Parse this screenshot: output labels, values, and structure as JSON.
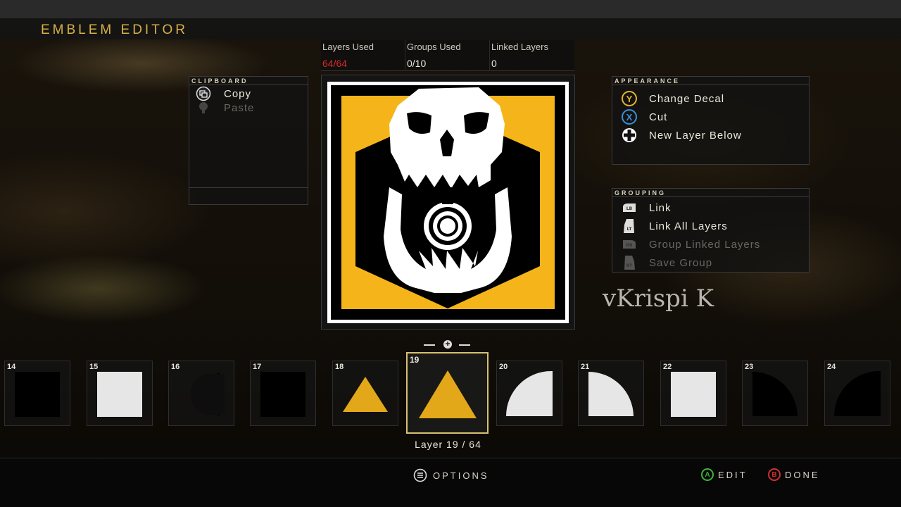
{
  "header": {
    "title": "EMBLEM EDITOR"
  },
  "stats": {
    "layers_used_label": "Layers Used",
    "layers_used_value": "64/64",
    "groups_used_label": "Groups Used",
    "groups_used_value": "0/10",
    "linked_layers_label": "Linked Layers",
    "linked_layers_value": "0"
  },
  "clipboard": {
    "heading": "CLIPBOARD",
    "items": [
      {
        "label": "Copy",
        "icon": "copy-icon",
        "enabled": true
      },
      {
        "label": "Paste",
        "icon": "paste-icon",
        "enabled": false
      }
    ]
  },
  "appearance": {
    "heading": "APPEARANCE",
    "items": [
      {
        "label": "Change Decal",
        "button": "Y",
        "color": "#e0b530"
      },
      {
        "label": "Cut",
        "button": "X",
        "color": "#3a8fd8"
      },
      {
        "label": "New Layer Below",
        "button": "dpad",
        "color": "#ffffff"
      }
    ]
  },
  "grouping": {
    "heading": "GROUPING",
    "items": [
      {
        "label": "Link",
        "button": "LB",
        "enabled": true
      },
      {
        "label": "Link All Layers",
        "button": "LT",
        "enabled": true
      },
      {
        "label": "Group Linked Layers",
        "button": "RB",
        "enabled": false
      },
      {
        "label": "Save Group",
        "button": "RT",
        "enabled": false
      }
    ]
  },
  "watermark": "vKrispi K",
  "layers": {
    "items": [
      {
        "num": "14",
        "shape": "square",
        "color": "#000000"
      },
      {
        "num": "15",
        "shape": "square",
        "color": "#e6e6e6"
      },
      {
        "num": "16",
        "shape": "crescent",
        "color": "#000000"
      },
      {
        "num": "17",
        "shape": "square",
        "color": "#000000"
      },
      {
        "num": "18",
        "shape": "triangle",
        "color": "#e3a71a"
      },
      {
        "num": "19",
        "shape": "triangle",
        "color": "#e3a71a"
      },
      {
        "num": "20",
        "shape": "half-circle",
        "color": "#e6e6e6"
      },
      {
        "num": "21",
        "shape": "quarter-circle",
        "color": "#e6e6e6"
      },
      {
        "num": "22",
        "shape": "square",
        "color": "#e6e6e6"
      },
      {
        "num": "23",
        "shape": "quarter-circle",
        "color": "#000000"
      },
      {
        "num": "24",
        "shape": "half-circle",
        "color": "#000000"
      }
    ],
    "selected_label": "Layer 19 / 64"
  },
  "footer": {
    "options_label": "OPTIONS",
    "edit_button": "A",
    "edit_label": "EDIT",
    "done_button": "B",
    "done_label": "DONE"
  },
  "colors": {
    "accent": "#d8b04a",
    "emblem_yellow": "#f5b51a",
    "warning_red": "#d92a2a"
  }
}
